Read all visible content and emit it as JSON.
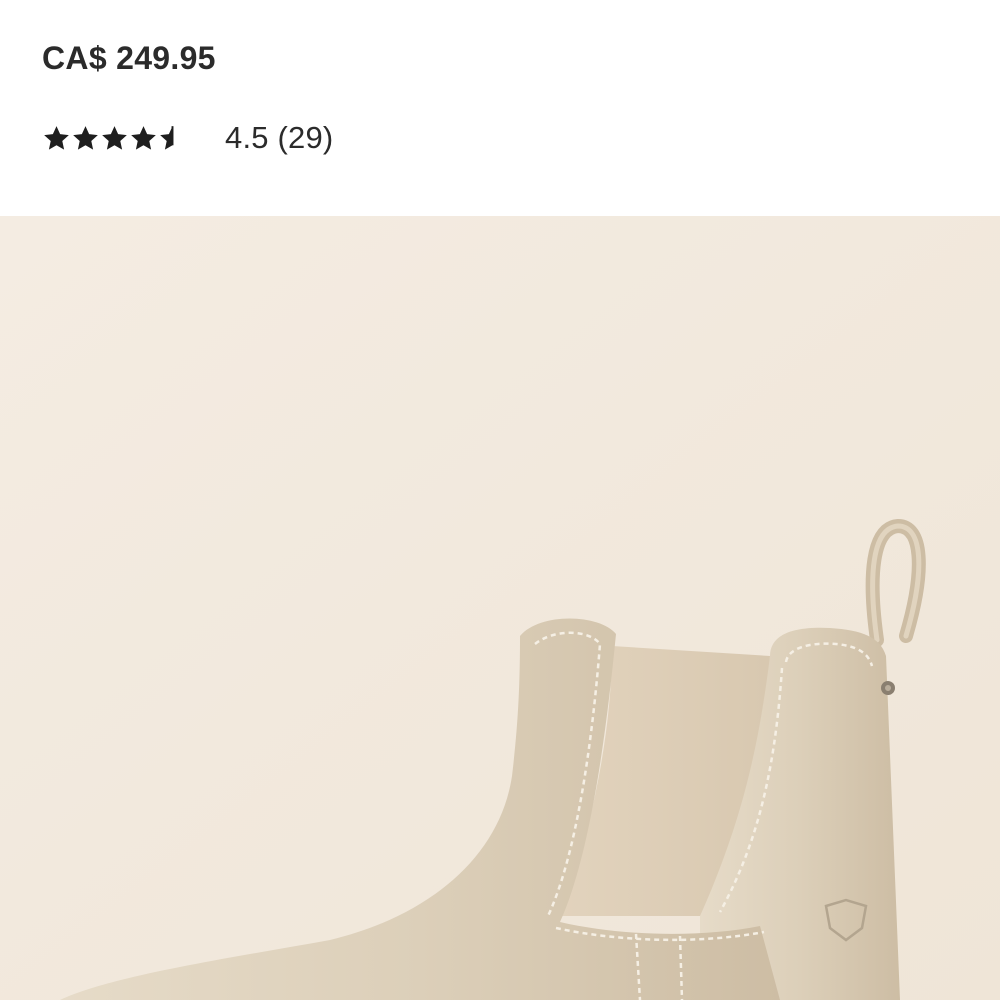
{
  "product": {
    "price": "CA$ 249.95",
    "rating": {
      "value": 4.5,
      "max": 5,
      "label": "4.5",
      "count_label": "(29)"
    }
  },
  "image": {
    "icon": "chelsea-boot-icon",
    "background_color": "#f3ebe0",
    "boot_color": "#d9cbb4"
  }
}
